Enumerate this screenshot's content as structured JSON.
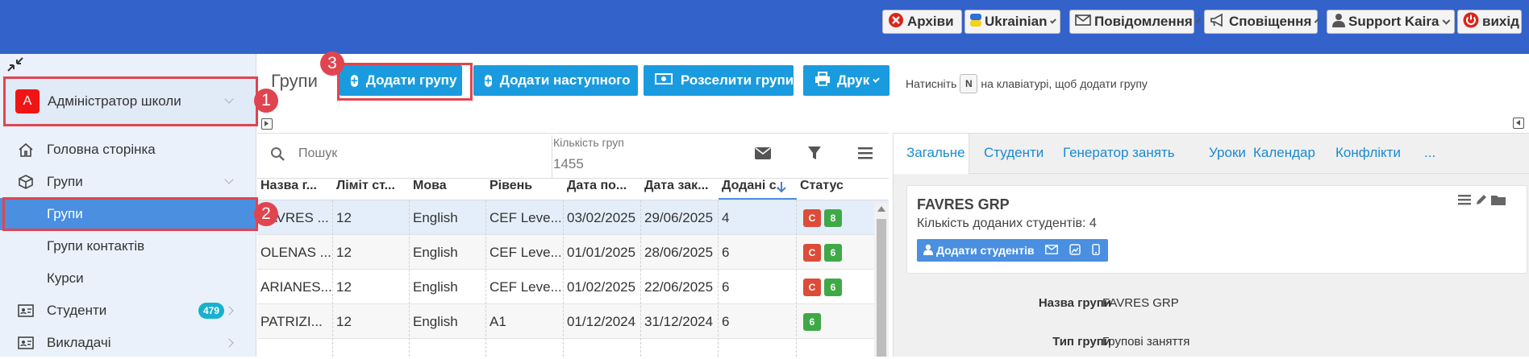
{
  "topbar": {
    "archives": "Архіви",
    "language": "Ukrainian",
    "messages": "Повідомлення",
    "notifications": "Сповіщення",
    "user": "Support Kaira",
    "logout": "вихід",
    "accent": "#3462cb"
  },
  "sidebar": {
    "role_initial": "A",
    "role": "Адміністратор школи",
    "items": [
      {
        "label": "Головна сторінка",
        "icon": "home-icon"
      },
      {
        "label": "Групи",
        "icon": "box-icon"
      },
      {
        "label": "Групи"
      },
      {
        "label": "Групи контактів"
      },
      {
        "label": "Курси"
      },
      {
        "label": "Студенти",
        "icon": "id-card-icon",
        "badge": "479"
      },
      {
        "label": "Викладачі",
        "icon": "id-card-icon"
      }
    ]
  },
  "annotations": [
    "1",
    "2",
    "3"
  ],
  "toolbar": {
    "title": "Групи",
    "add_group": "Додати групу",
    "add_next": "Додати наступного",
    "split_groups": "Розселити групи",
    "print": "Друк",
    "hint_pre": "Натисніть",
    "hint_key": "N",
    "hint_post": "на клавіатурі, щоб додати групу"
  },
  "search": {
    "placeholder": "Пошук",
    "count_label": "Кількість груп",
    "count_value": "1455"
  },
  "table": {
    "headers": [
      "Назва г...",
      "Ліміт ст...",
      "Мова",
      "Рівень",
      "Дата по...",
      "Дата зак...",
      "Додані с...",
      "Статус"
    ],
    "rows": [
      {
        "name": "FAVRES ...",
        "limit": "12",
        "lang": "English",
        "level": "CEF Leve...",
        "start": "03/02/2025",
        "end": "29/06/2025",
        "added": "4",
        "c": "C",
        "n": "8"
      },
      {
        "name": "OLENAS ...",
        "limit": "12",
        "lang": "English",
        "level": "CEF Leve...",
        "start": "01/01/2025",
        "end": "28/06/2025",
        "added": "6",
        "c": "C",
        "n": "6"
      },
      {
        "name": "ARIANES...",
        "limit": "12",
        "lang": "English",
        "level": "CEF Leve...",
        "start": "01/02/2025",
        "end": "22/06/2025",
        "added": "6",
        "c": "C",
        "n": "6"
      },
      {
        "name": "PATRIZI...",
        "limit": "12",
        "lang": "English",
        "level": "A1",
        "start": "01/12/2024",
        "end": "31/12/2024",
        "added": "6",
        "c": "",
        "n": "6"
      }
    ]
  },
  "detail": {
    "tabs": [
      "Загальне",
      "Студенти",
      "Генератор занять",
      "Уроки",
      "Календар",
      "Конфлікти",
      "..."
    ],
    "group_name": "FAVRES GRP",
    "students_added": "Кількість доданих студентів: 4",
    "add_students": "Додати студентів",
    "fields": [
      {
        "label": "Назва групи",
        "value": "FAVRES GRP"
      },
      {
        "label": "Тип групи",
        "value": "Групові заняття"
      }
    ]
  }
}
